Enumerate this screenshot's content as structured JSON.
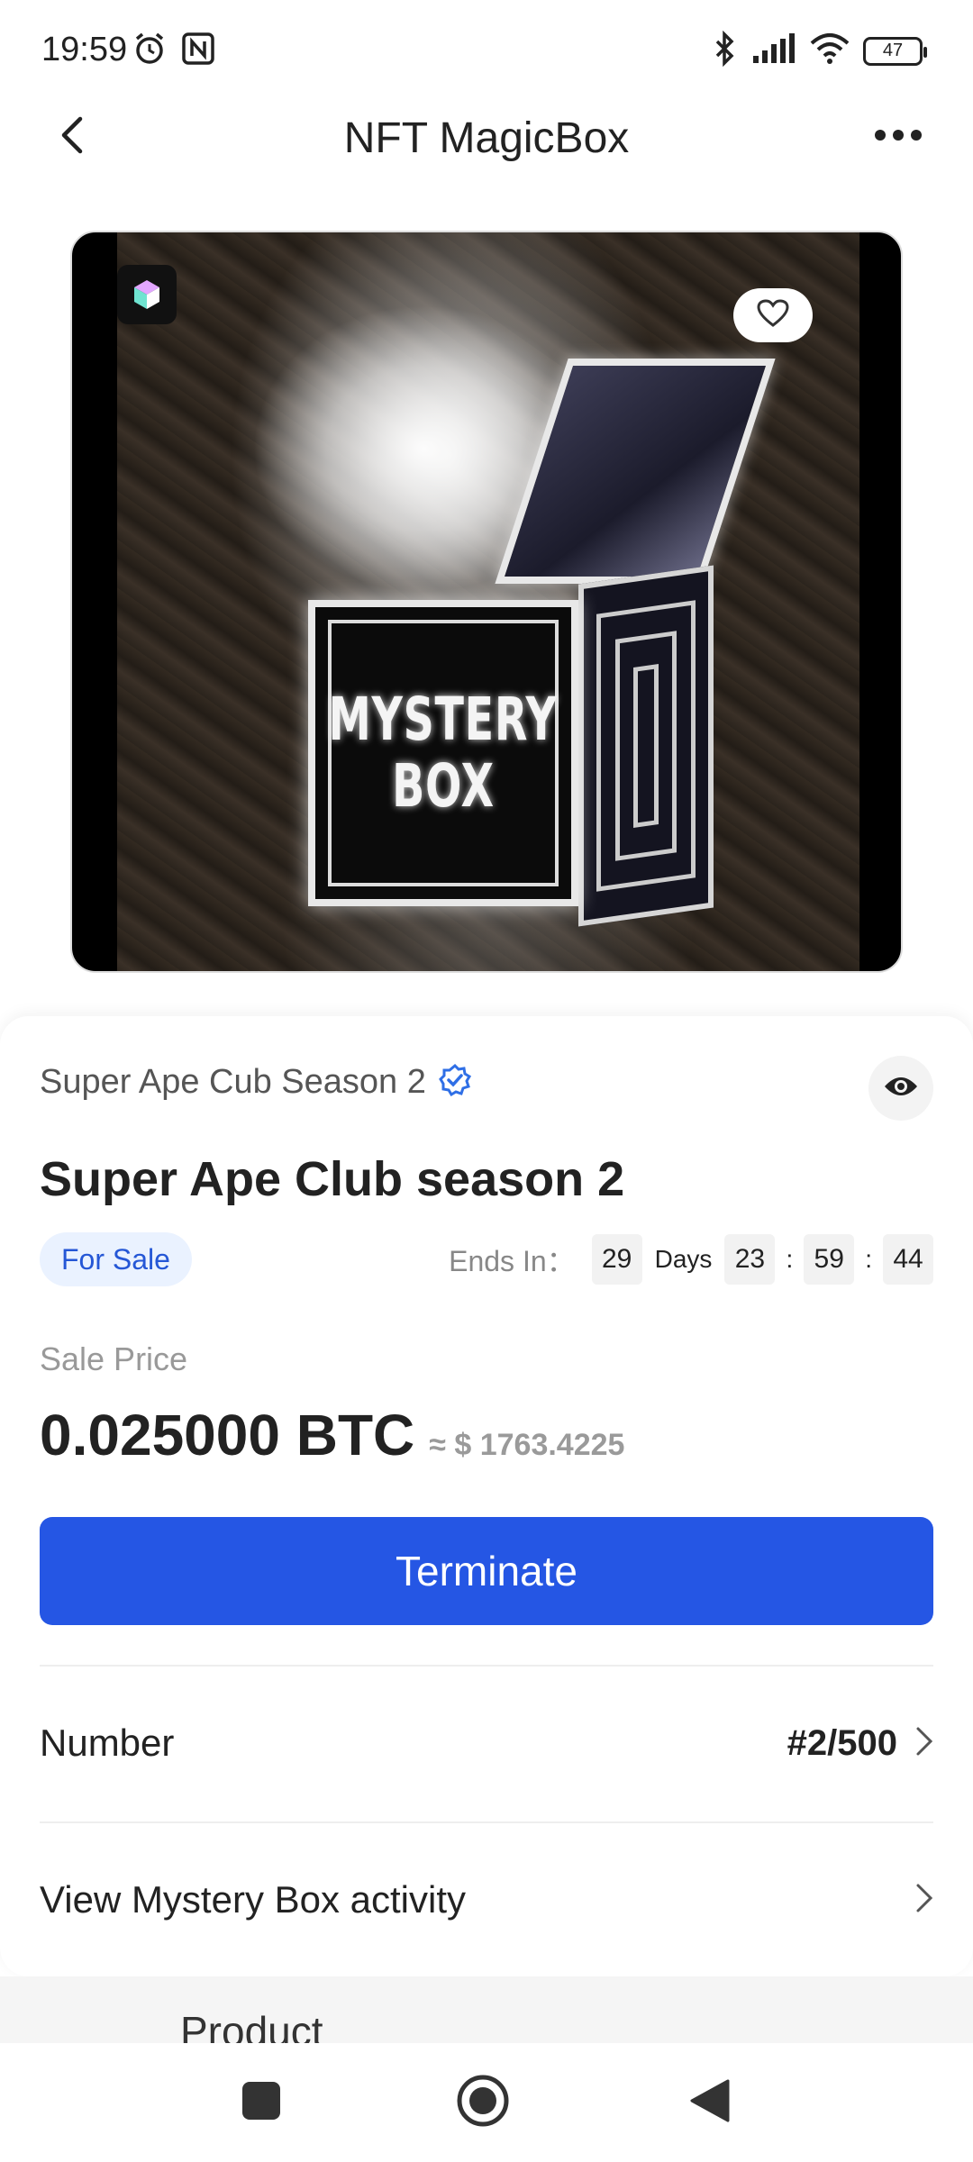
{
  "status_bar": {
    "time": "19:59",
    "battery": "47",
    "icons": [
      "alarm-icon",
      "nfc-icon",
      "bluetooth-icon",
      "signal-icon",
      "wifi-icon",
      "battery-icon"
    ]
  },
  "header": {
    "title": "NFT MagicBox",
    "back_icon": "chevron-left-icon",
    "more_icon": "more-horizontal-icon"
  },
  "hero": {
    "box_text_line1": "MYSTERY",
    "box_text_line2": "BOX",
    "badge_icon": "cube-icon",
    "favorite_icon": "heart-icon"
  },
  "nft": {
    "collection": "Super Ape Cub Season 2",
    "verified_icon": "verified-badge-icon",
    "view_icon": "eye-icon",
    "title": "Super Ape Club season 2",
    "status": "For Sale"
  },
  "countdown": {
    "label": "Ends In：",
    "days": "29",
    "days_unit": "Days",
    "hours": "23",
    "minutes": "59",
    "seconds": "44",
    "separator": ":"
  },
  "price": {
    "label": "Sale Price",
    "amount": "0.025000 BTC",
    "usd": "≈ $ 1763.4225"
  },
  "actions": {
    "terminate": "Terminate"
  },
  "details": {
    "number_label": "Number",
    "number_value": "#2/500",
    "activity_label": "View Mystery Box activity"
  },
  "below": {
    "section_title": "Product"
  },
  "colors": {
    "accent": "#2556e4",
    "badge_bg": "#eaf2ff",
    "badge_text": "#2557d6",
    "verified": "#2f6fe6"
  },
  "nav": {
    "icons": [
      "recents-square-icon",
      "home-circle-icon",
      "back-triangle-icon"
    ]
  }
}
